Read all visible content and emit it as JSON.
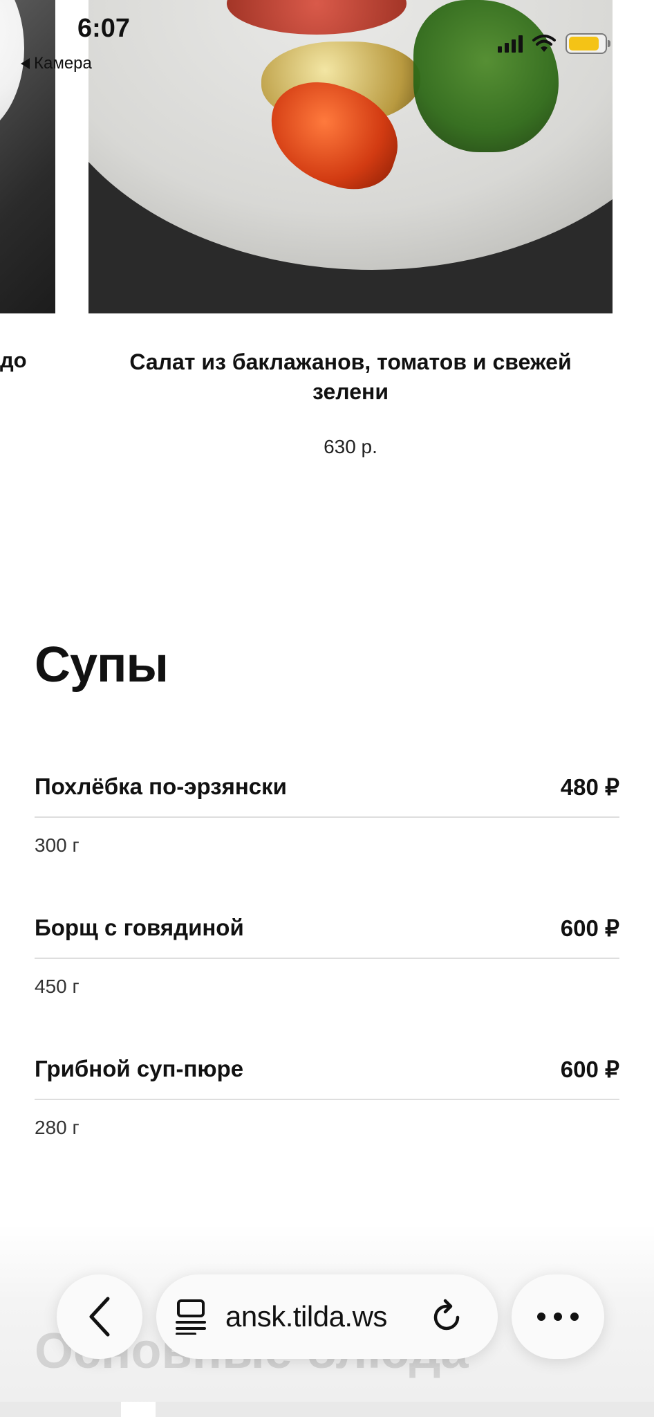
{
  "status_bar": {
    "time": "6:07",
    "back_label": "Камера",
    "battery_color": "#f4c316"
  },
  "carousel": {
    "prev_caption_fragment": "до",
    "current_title": "Салат из баклажанов, томатов и свежей зелени",
    "current_price": "630 р."
  },
  "soups": {
    "title": "Супы",
    "items": [
      {
        "name": "Похлёбка по-эрзянски",
        "price": "480 ₽",
        "weight": "300 г"
      },
      {
        "name": "Борщ с говядиной",
        "price": "600 ₽",
        "weight": "450 г"
      },
      {
        "name": "Грибной суп-пюре",
        "price": "600 ₽",
        "weight": "280 г"
      }
    ]
  },
  "next_section": {
    "title": "Основные блюда"
  },
  "browser": {
    "url": "ansk.tilda.ws",
    "icons": [
      "back-icon",
      "reader-icon",
      "reload-icon",
      "more-icon"
    ]
  }
}
